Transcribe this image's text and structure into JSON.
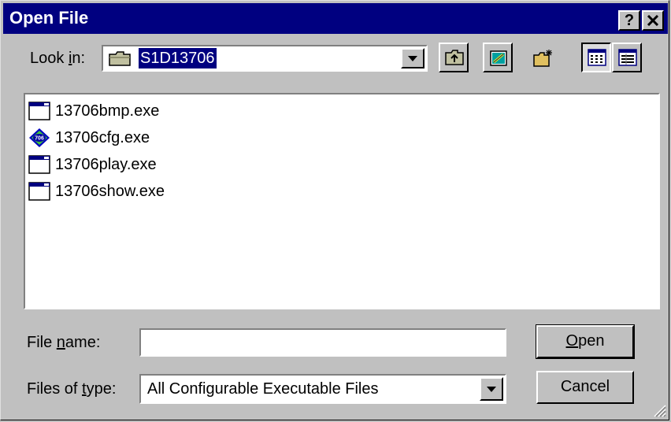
{
  "window": {
    "title": "Open File",
    "help_label": "?",
    "close_label": "×"
  },
  "look_in": {
    "label_prefix": "Look ",
    "label_mnemonic": "i",
    "label_suffix": "n:",
    "folder_name": "S1D13706"
  },
  "toolbar": {
    "items": [
      "up-one-level",
      "desktop",
      "create-new-folder",
      "list-view",
      "details-view"
    ]
  },
  "files": [
    {
      "name": "13706bmp.exe",
      "icon": "app-window-icon"
    },
    {
      "name": "13706cfg.exe",
      "icon": "config-app-icon"
    },
    {
      "name": "13706play.exe",
      "icon": "app-window-icon"
    },
    {
      "name": "13706show.exe",
      "icon": "app-window-icon"
    }
  ],
  "config_icon_text": "706",
  "file_name": {
    "label_prefix": "File ",
    "label_mnemonic": "n",
    "label_suffix": "ame:",
    "value": ""
  },
  "file_type": {
    "label_prefix": "Files of ",
    "label_mnemonic": "t",
    "label_suffix": "ype:",
    "value": "All Configurable Executable Files"
  },
  "buttons": {
    "open_mnemonic": "O",
    "open_rest": "pen",
    "cancel": "Cancel"
  },
  "colors": {
    "titlebar": "#000080",
    "face": "#c0c0c0",
    "selection": "#000080"
  }
}
